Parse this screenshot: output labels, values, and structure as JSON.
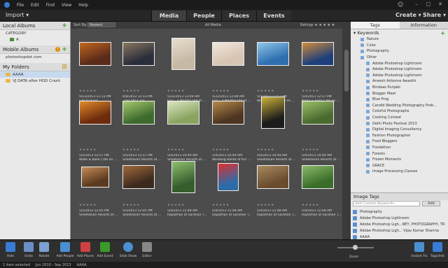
{
  "menubar": {
    "items": [
      "File",
      "Edit",
      "Find",
      "View",
      "Help"
    ],
    "window_controls": [
      "–",
      "□",
      "✕"
    ]
  },
  "modebar": {
    "import_label": "Import ▾",
    "tabs": [
      "Media",
      "People",
      "Places",
      "Events"
    ],
    "active_tab": "Media",
    "create_label": "Create ▾",
    "share_label": "Share ▾"
  },
  "leftpanel": {
    "local_albums": "Local Albums",
    "category": "CATEGORY",
    "album_a": "A",
    "mobile_albums": "Mobile Albums",
    "mobile_account": "photoshopdot.com",
    "my_folders": "My Folders",
    "folders": [
      "AAAA",
      "VJ DATA after HDD Crash"
    ]
  },
  "gridbar": {
    "sort_label": "Sort By:",
    "sort_value": "Newest",
    "view_label": "All Media",
    "ratings_label": "Ratings  ★ ★ ★ ★ ★"
  },
  "grid": {
    "cells": [
      {
        "meta": "9/23/2013 11:13 PM",
        "meta2": "SAP Killpost"
      },
      {
        "meta": "6/9/2013 12:13 PM",
        "meta2": "_DSC0851.jpg"
      },
      {
        "meta": "5/22/2013 12:09 AM",
        "meta2": "Unn - 4 Months Old at ..."
      },
      {
        "meta": "5/22/2013 12:09 AM",
        "meta2": "Unn - 4 Months Old at ..."
      },
      {
        "meta": "5/4/2013 12:57 PM",
        "meta2": "Wake & Bake Cafe on ..."
      },
      {
        "meta": "5/4/2013 12:57 PM",
        "meta2": "Wake & Bake Cafe on ..."
      },
      {
        "meta": "5/5/2013 12:57 PM",
        "meta2": "Wake & Bake Cafe on ..."
      },
      {
        "meta": "5/5/2013 12:17 PM",
        "meta2": "Sheetalvan Resorts at ..."
      },
      {
        "meta": "5/4/2013 10:49 AM",
        "meta2": "Sheetalvan Resorts at ..."
      },
      {
        "meta": "5/4/2013 10:49 AM",
        "meta2": "Wedding Bands of Kin ..."
      },
      {
        "meta": "5/4/2013 10:49 AM",
        "meta2": "Sheetalvan Resorts at ..."
      },
      {
        "meta": "5/4/2013 10:49 AM",
        "meta2": "Sheetalvan Resorts at ..."
      },
      {
        "meta": "5/5/2013 12:05 PM",
        "meta2": "Sheetalvan Resorts at ..."
      },
      {
        "meta": "5/5/2013 12:05 PM",
        "meta2": "Sheetalvan Resorts at ..."
      },
      {
        "meta": "5/4/2013 11:48 AM",
        "meta2": "Rajasthan at Sarahan T..."
      },
      {
        "meta": "5/4/2013 11:48 AM",
        "meta2": "Rajasthan at Sarahan T..."
      },
      {
        "meta": "5/4/2013 11:48 AM",
        "meta2": "Rajasthan at Sarahan T..."
      },
      {
        "meta": "5/4/2013 11:48 AM",
        "meta2": "Rajasthan at Sarahan T..."
      }
    ]
  },
  "rightpanel": {
    "tabs": [
      "Tags",
      "Information"
    ],
    "keywords_label": "Keywords",
    "keywords": [
      "Nature",
      "Color",
      "Photography",
      "Other"
    ],
    "other_tags": [
      "Adobe Photoshop Lightroom",
      "Adobe Photoshop Lightroom",
      "Adobe Photoshop Lightroom",
      "Aneesh Airborne Awasthi",
      "Bindaas Punjabi",
      "Blogger Meet",
      "Blue Frog",
      "Candid Wedding Photography Prob...",
      "Colorful Photographs",
      "Cooking Contest",
      "Delhi Photo Festival 2013",
      "Digital Imaging Consultancy",
      "Fashion Photographer",
      "Food Bloggers",
      "Foodathon",
      "Forests",
      "Frozen Moments",
      "GRACE",
      "Image Processing Classes"
    ],
    "image_tags_label": "Image Tags",
    "custom_keywords_placeholder": "Add Custom Keywords",
    "add_label": "Add",
    "image_tags": [
      "Photography",
      "Adobe Photoshop Lightroom",
      "Adobe Photoshop Ligh...NEY, PHOTOGRAPHY, TR",
      "Adobe Photoshop Ligh... Vijay Kumar Sharma",
      "AAAA"
    ]
  },
  "bottombar": {
    "buttons": [
      "Hide",
      "Undo",
      "Rotate",
      "Add People",
      "Add Places",
      "Add Event",
      "Slide Show",
      "Editor"
    ],
    "zoom_label": "Zoom",
    "right_buttons": [
      "Instant Fix",
      "Tags/Info"
    ]
  },
  "statusbar": {
    "selection": "1 item selected",
    "range": "Jun 2010 - Sep 2013",
    "folder": "AAAA"
  },
  "colors": {
    "accent": "#3a7bd5",
    "grid_bg": "#4c4c4c",
    "panel_bg": "#e9e9e9",
    "plus_green": "#3a9b2a",
    "warn_orange": "#e08a00"
  }
}
